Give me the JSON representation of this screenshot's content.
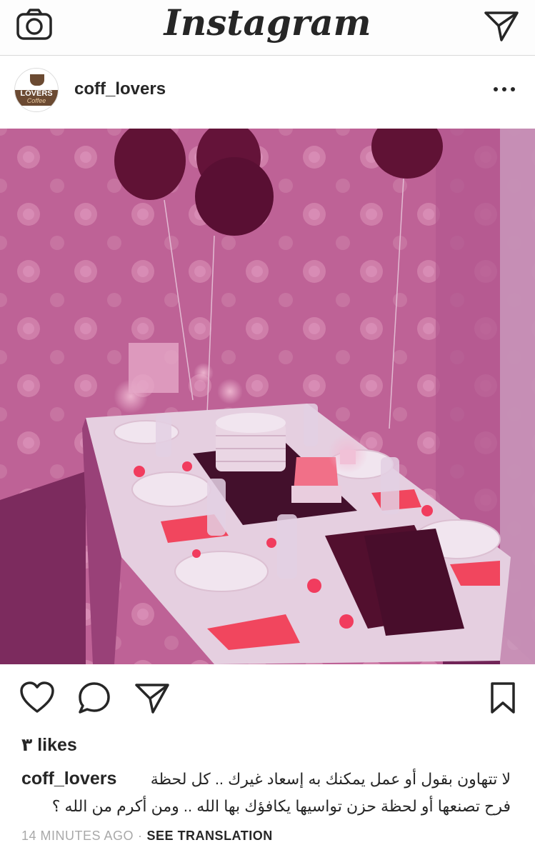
{
  "app": {
    "title": "Instagram"
  },
  "header": {
    "camera_icon": "camera-icon",
    "direct_icon": "paper-plane-icon"
  },
  "post": {
    "username": "coff_lovers",
    "avatar": {
      "line1": "LOVERS",
      "line2": "Coffee"
    },
    "more_icon": "more-horizontal-icon",
    "image": {
      "description_icon": "photo"
    },
    "actions": {
      "like_icon": "heart-icon",
      "comment_icon": "comment-icon",
      "share_icon": "paper-plane-icon",
      "save_icon": "bookmark-icon"
    },
    "likes": "٣ likes",
    "caption": {
      "username": "coff_lovers",
      "line1": "لا تتهاون بقول أو عمل يمكنك به إسعاد غيرك .. كل لحظة",
      "line2": "فرح تصنعها أو لحظة حزن تواسيها يكافؤك بها الله .. ومن أكرم من الله ؟"
    },
    "timestamp": "14 MINUTES AGO",
    "separator": "·",
    "see_translation": "SEE TRANSLATION"
  },
  "colors": {
    "accent": "#262626",
    "muted": "#a9a9a9",
    "photo_tint": "#b55a8a"
  }
}
